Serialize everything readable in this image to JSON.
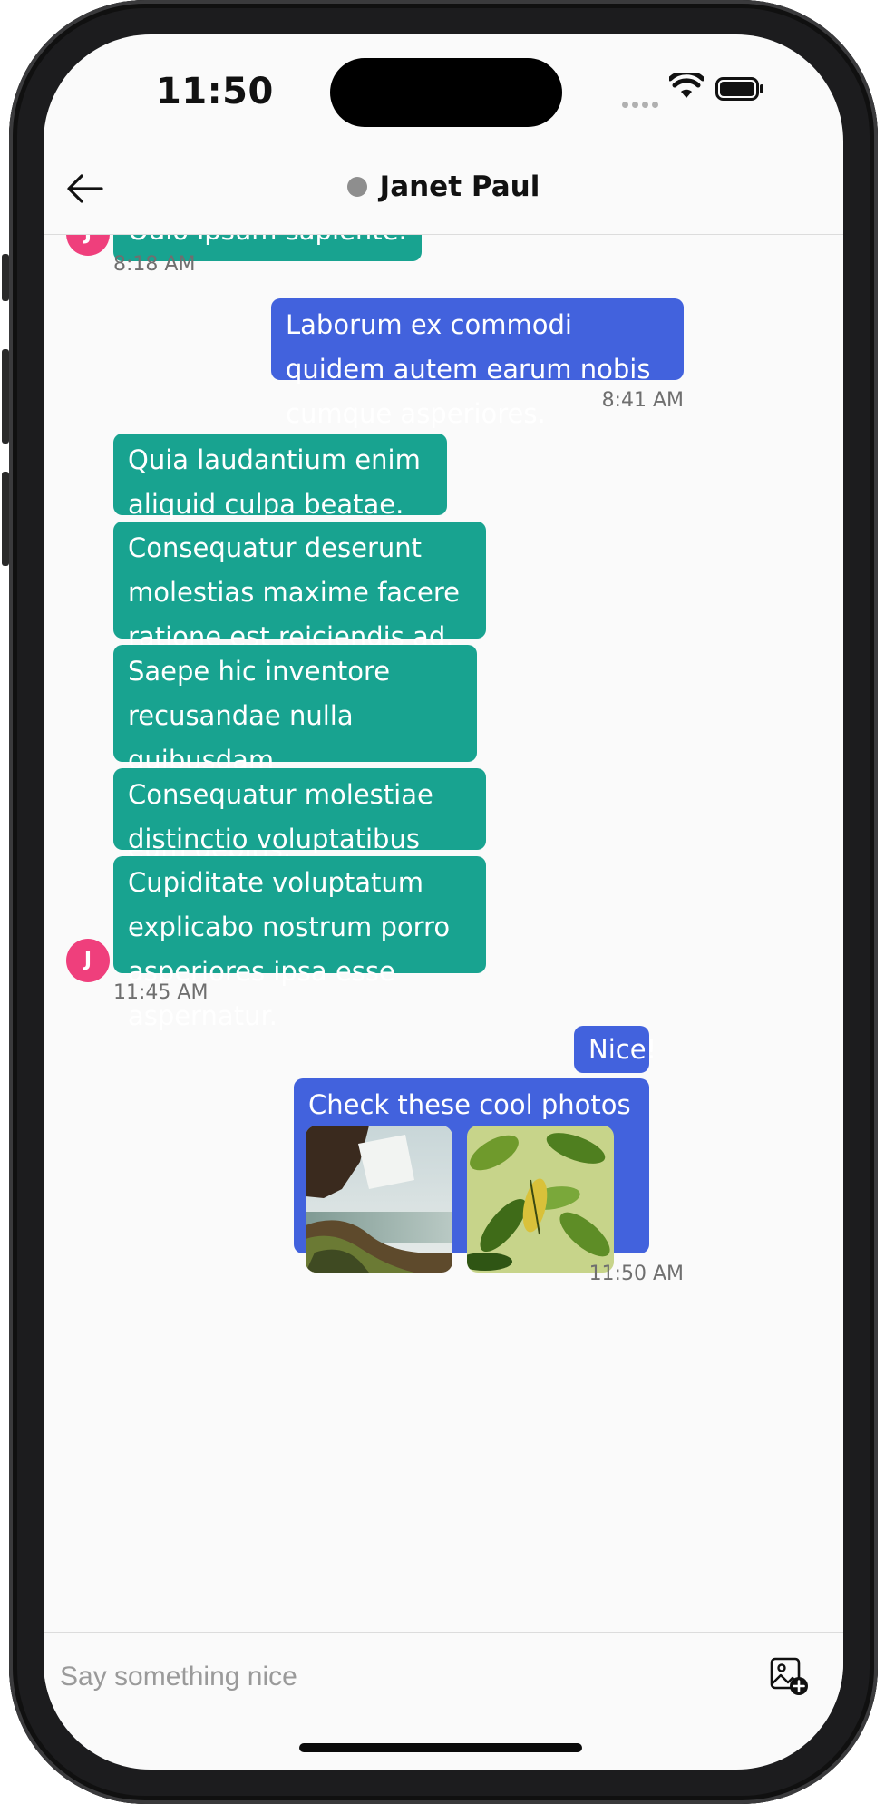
{
  "status_bar": {
    "time": "11:50"
  },
  "header": {
    "contact_name": "Janet Paul",
    "presence_color": "#8e8e8e"
  },
  "colors": {
    "incoming_bubble": "#18a390",
    "outgoing_bubble": "#4262dd",
    "avatar": "#ef3f7c"
  },
  "contact": {
    "avatar_initial": "J"
  },
  "messages": {
    "m0": {
      "text": "Odio ipsum sapiente.",
      "time": "8:18 AM"
    },
    "m1": {
      "text": "Laborum ex commodi quidem autem earum nobis cumque asperiores.",
      "time": "8:41 AM"
    },
    "m2": {
      "text": "Quia laudantium enim aliquid culpa beatae."
    },
    "m3": {
      "text": "Consequatur deserunt molestias maxime facere ratione est reiciendis ad."
    },
    "m4": {
      "text": "Saepe hic inventore recusandae nulla quibusdam reprehenderit blanditiis eum debitis."
    },
    "m5": {
      "text": "Consequatur molestiae distinctio voluptatibus tempore."
    },
    "m6": {
      "text": "Cupiditate voluptatum explicabo nostrum porro asperiores ipsa esse aspernatur.",
      "time": "11:45 AM"
    },
    "m7": {
      "text": "Nice!"
    },
    "m8": {
      "text": "Check these cool photos I took!",
      "time": "11:50 AM",
      "photos": [
        "waterfall-photo",
        "leaves-photo"
      ]
    }
  },
  "composer": {
    "placeholder": "Say something nice"
  },
  "icons": [
    "back-arrow-icon",
    "wifi-icon",
    "battery-icon",
    "add-image-icon"
  ]
}
